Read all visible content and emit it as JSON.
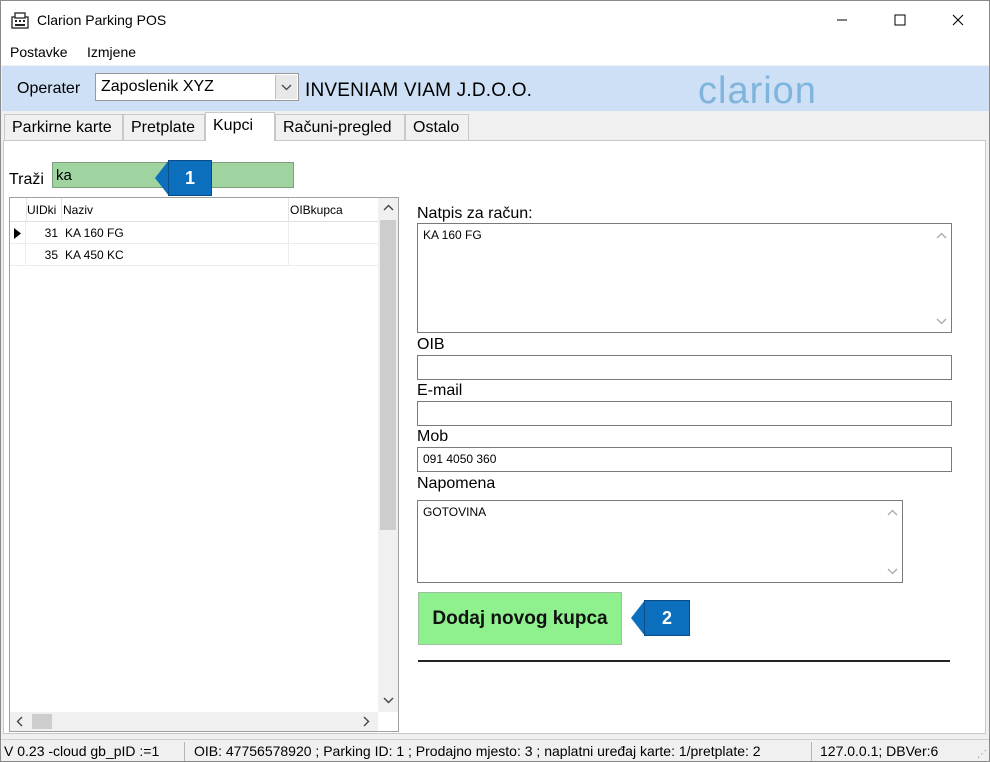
{
  "window": {
    "title": "Clarion Parking POS"
  },
  "menu": {
    "items": [
      "Postavke",
      "Izmjene"
    ]
  },
  "operator": {
    "label": "Operater",
    "selected": "Zaposlenik XYZ",
    "company": "INVENIAM VIAM J.D.O.O.",
    "logo": "clarion"
  },
  "tabs": [
    {
      "label": "Parkirne karte"
    },
    {
      "label": "Pretplate"
    },
    {
      "label": "Kupci",
      "active": true
    },
    {
      "label": "Računi-pregled"
    },
    {
      "label": "Ostalo"
    }
  ],
  "search": {
    "label": "Traži",
    "value": "ka"
  },
  "callouts": {
    "first": "1",
    "second": "2"
  },
  "grid": {
    "columns": [
      "UIDki",
      "Naziv",
      "OIBkupca"
    ],
    "rows": [
      {
        "id": "31",
        "name": "KA 160 FG",
        "oib": "",
        "selected": true
      },
      {
        "id": "35",
        "name": "KA 450 KC",
        "oib": ""
      }
    ]
  },
  "form": {
    "invoice_label": "Natpis za račun:",
    "invoice_value": "KA 160 FG",
    "oib_label": "OIB",
    "oib_value": "",
    "email_label": "E-mail",
    "email_value": "",
    "mob_label": "Mob",
    "mob_value": "091 4050 360",
    "note_label": "Napomena",
    "note_value": "GOTOVINA",
    "add_button": "Dodaj novog kupca"
  },
  "status": {
    "version": "V 0.23 -cloud gb_pID :=1",
    "info": "OIB: 47756578920 ; Parking ID: 1 ; Prodajno mjesto: 3 ; naplatni uređaj karte: 1/pretplate: 2",
    "server": "127.0.0.1; DBVer:6"
  },
  "colors": {
    "operator_band": "#cde0f5",
    "search_bg": "#9fd4a0",
    "add_button_bg": "#8ef18e",
    "callout": "#0b6fbe",
    "logo": "#7fb4dc"
  }
}
